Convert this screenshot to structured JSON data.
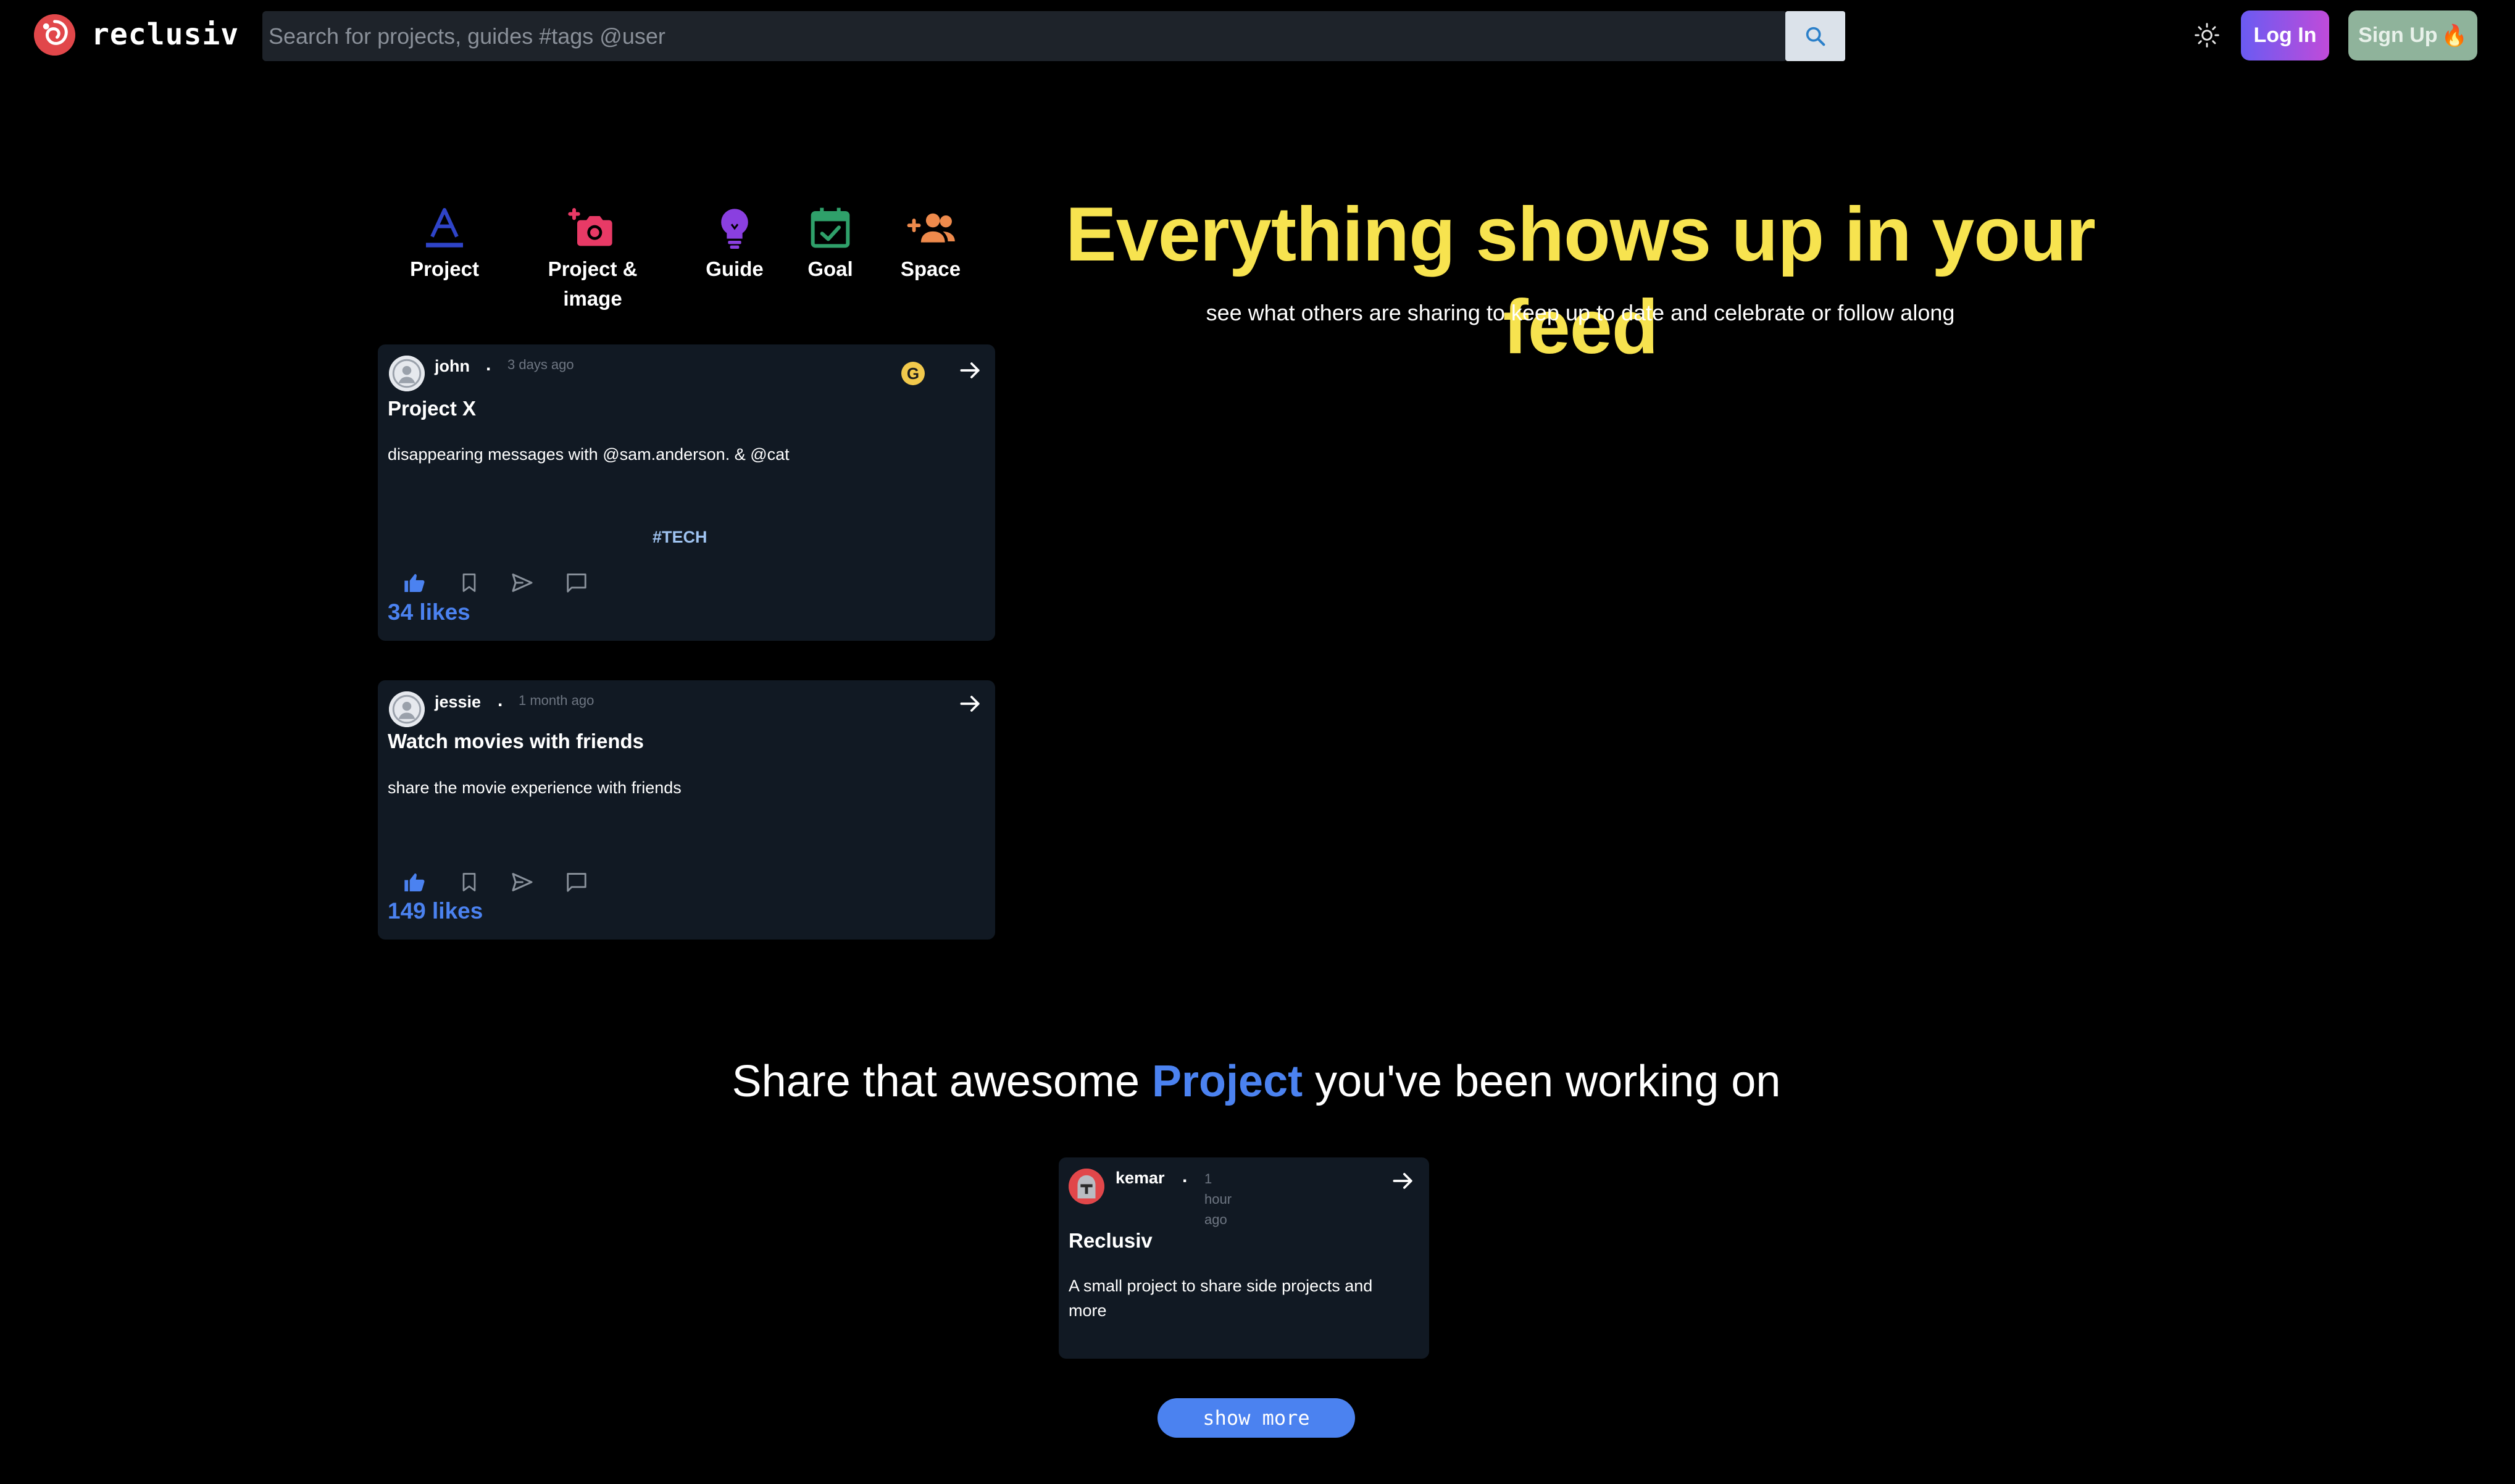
{
  "header": {
    "brand": "reclusiv",
    "search_placeholder": "Search for projects, guides #tags @user",
    "login_label": "Log In",
    "signup_label": "Sign Up",
    "signup_emoji": "🔥"
  },
  "post_types": [
    {
      "label": "Project",
      "icon": "text-a-icon",
      "color": "#2f44c8"
    },
    {
      "label": "Project & image",
      "icon": "camera-plus-icon",
      "color": "#e83a66"
    },
    {
      "label": "Guide",
      "icon": "lightbulb-icon",
      "color": "#8a3fe0"
    },
    {
      "label": "Goal",
      "icon": "calendar-check-icon",
      "color": "#2fa06a"
    },
    {
      "label": "Space",
      "icon": "group-add-icon",
      "color": "#ee8a4c"
    }
  ],
  "hero": {
    "title": "Everything shows up in your feed",
    "subtitle": "see what others are sharing to keep up to date and celebrate or follow along"
  },
  "feed": [
    {
      "user": "john",
      "time": "3 days ago",
      "badge": "G",
      "title": "Project X",
      "description": "disappearing messages with @sam.anderson. & @cat",
      "tag": "#TECH",
      "likes": "34 likes"
    },
    {
      "user": "jessie",
      "time": "1 month ago",
      "title": "Watch movies with friends",
      "description": "share the movie experience with friends",
      "likes": "149 likes"
    }
  ],
  "share": {
    "prefix": "Share that awesome",
    "highlight": "Project",
    "suffix": "you've been working on"
  },
  "project_card": {
    "user": "kemar",
    "time": "1 hour ago",
    "title": "Reclusiv",
    "description": "A small project to share side projects and more"
  },
  "show_more_label": "show more",
  "colors": {
    "background": "#000000",
    "card": "#111923",
    "hero": "#f7e34f",
    "accent": "#4b82f0"
  }
}
